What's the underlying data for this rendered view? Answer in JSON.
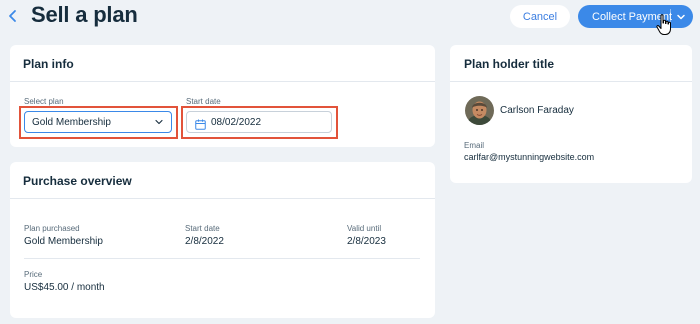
{
  "header": {
    "title": "Sell a plan",
    "cancel_label": "Cancel",
    "collect_label": "Collect Payment"
  },
  "plan_info": {
    "title": "Plan info",
    "select_plan_label": "Select plan",
    "select_plan_value": "Gold Membership",
    "start_date_label": "Start date",
    "start_date_value": "08/02/2022"
  },
  "purchase_overview": {
    "title": "Purchase overview",
    "plan_purchased_label": "Plan purchased",
    "plan_purchased_value": "Gold Membership",
    "start_date_label": "Start date",
    "start_date_value": "2/8/2022",
    "valid_until_label": "Valid until",
    "valid_until_value": "2/8/2023",
    "price_label": "Price",
    "price_value": "US$45.00 / month"
  },
  "plan_holder": {
    "title": "Plan holder title",
    "name": "Carlson Faraday",
    "email_label": "Email",
    "email_value": "carlfar@mystunningwebsite.com"
  },
  "colors": {
    "primary": "#3b89e8",
    "highlight": "#e2533a",
    "background": "#eef2f6"
  }
}
